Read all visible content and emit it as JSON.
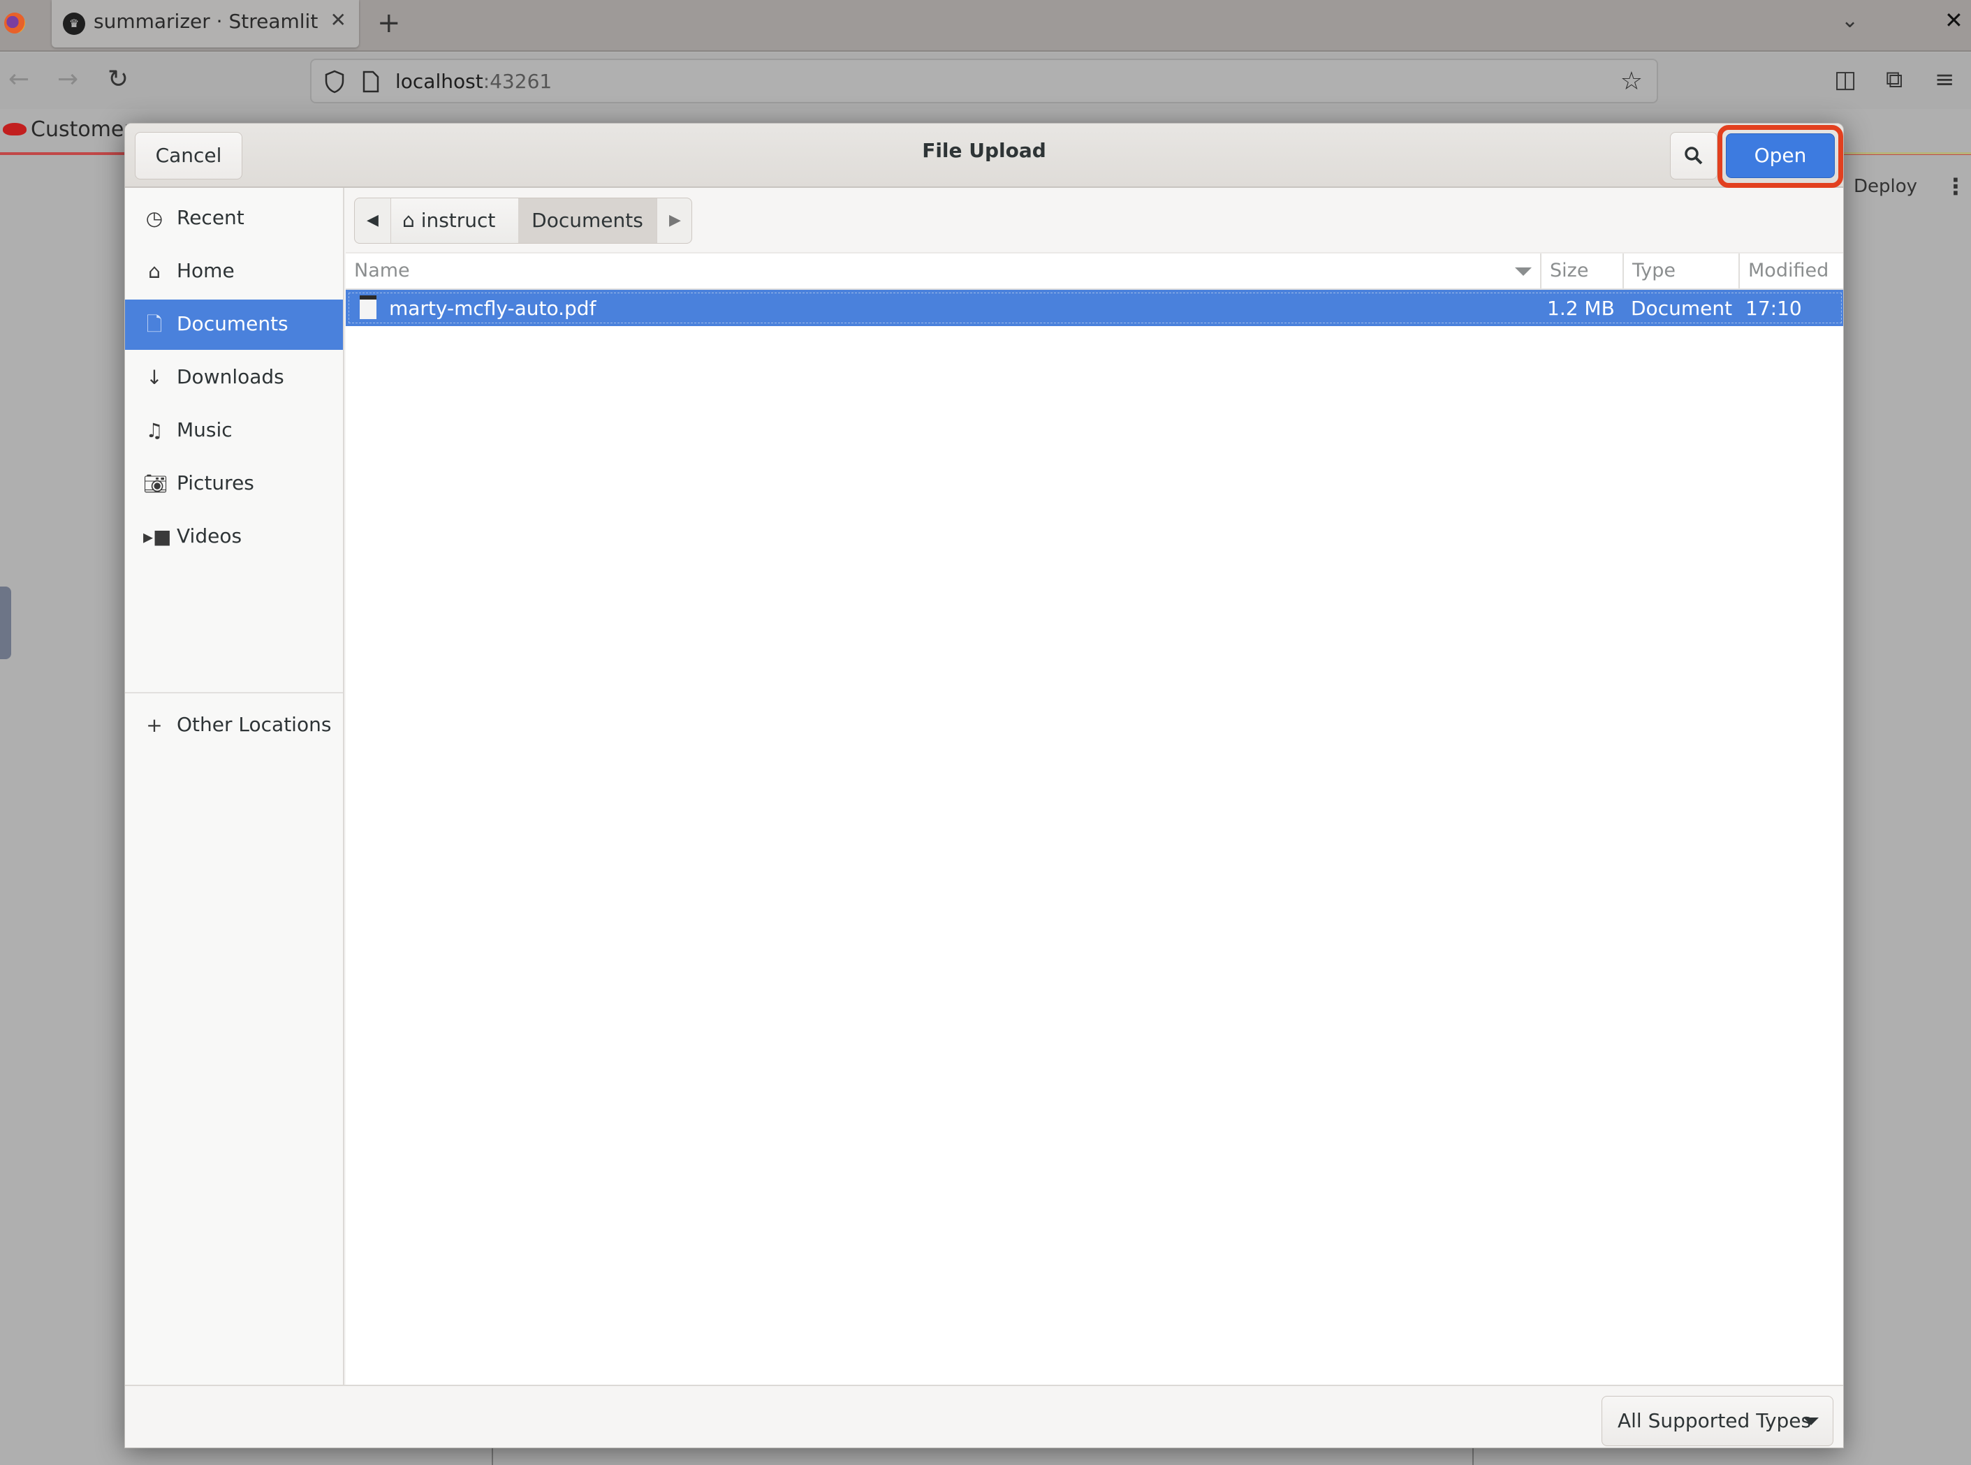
{
  "browser": {
    "tab": {
      "title": "summarizer · Streamlit",
      "close_icon": "close-icon"
    },
    "new_tab_label": "+",
    "url": {
      "host": "localhost",
      "port": ":43261"
    },
    "bookmark": {
      "label": "Customer"
    },
    "streamlit": {
      "deploy_label": "Deploy"
    }
  },
  "dialog": {
    "title": "File Upload",
    "cancel_label": "Cancel",
    "open_label": "Open",
    "places": [
      {
        "label": "Recent",
        "icon": "clock-icon",
        "active": false
      },
      {
        "label": "Home",
        "icon": "home-icon",
        "active": false
      },
      {
        "label": "Documents",
        "icon": "document-icon",
        "active": true
      },
      {
        "label": "Downloads",
        "icon": "download-icon",
        "active": false
      },
      {
        "label": "Music",
        "icon": "music-icon",
        "active": false
      },
      {
        "label": "Pictures",
        "icon": "camera-icon",
        "active": false
      },
      {
        "label": "Videos",
        "icon": "video-icon",
        "active": false
      },
      {
        "label": "Other Locations",
        "icon": "plus-icon",
        "active": false
      }
    ],
    "pathbar": {
      "segments": [
        "instruct",
        "Documents"
      ],
      "active_segment": "Documents"
    },
    "columns": [
      "Name",
      "Size",
      "Type",
      "Modified"
    ],
    "files": [
      {
        "name": "marty-mcfly-auto.pdf",
        "size": "1.2 MB",
        "type": "Document",
        "modified": "17:10",
        "selected": true
      }
    ],
    "filter": {
      "selected": "All Supported Types"
    },
    "colors": {
      "accent": "#4a81dc",
      "open_button": "#3d7be0",
      "highlight_ring": "#e2401f"
    }
  }
}
